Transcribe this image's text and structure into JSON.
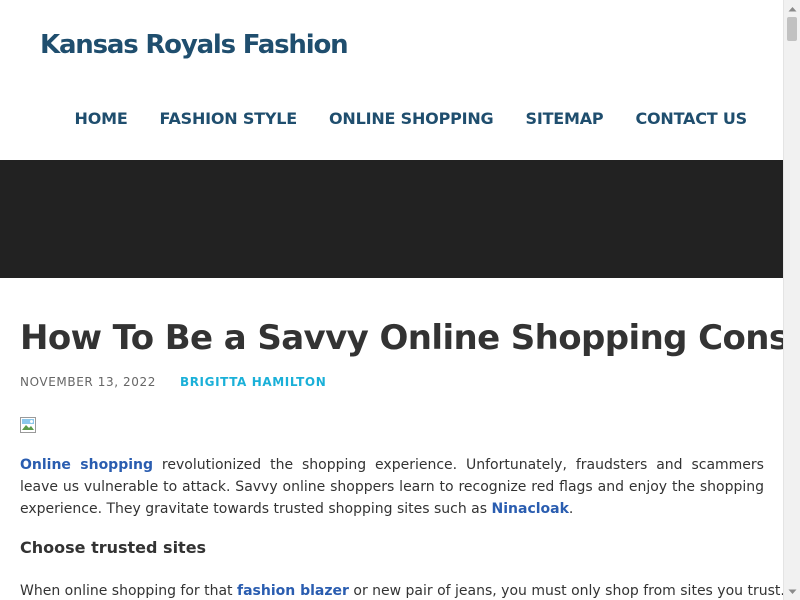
{
  "site": {
    "title": "Kansas Royals Fashion"
  },
  "nav": {
    "items": [
      {
        "label": "HOME"
      },
      {
        "label": "FASHION STYLE"
      },
      {
        "label": "ONLINE SHOPPING"
      },
      {
        "label": "SITEMAP"
      },
      {
        "label": "CONTACT US"
      }
    ]
  },
  "post": {
    "title": "How To Be a Savvy Online Shopping Consumer",
    "date": "NOVEMBER 13, 2022",
    "author": "BRIGITTA HAMILTON",
    "p1": {
      "link1": "Online shopping",
      "text1": " revolutionized the shopping experience. Unfortunately, fraudsters and scammers leave us vulnerable to attack. Savvy online shoppers learn to recognize red flags and enjoy the shopping experience. They gravitate towards trusted shopping sites such as ",
      "link2": "Ninacloak",
      "text2": "."
    },
    "subheading": "Choose trusted sites",
    "p2": {
      "text1": "When online shopping for that ",
      "link1": "fashion blazer",
      "text2": " or new pair of jeans, you must only shop from sites you trust. If you"
    }
  },
  "colors": {
    "title": "#1f4e6e",
    "nav": "#1f4e6e",
    "hero": "#222222",
    "author": "#1ab0d8",
    "link": "#2a5db0"
  },
  "icons": {
    "broken_image": "broken-image-icon",
    "scroll_up": "arrow-up-icon",
    "scroll_down": "arrow-down-icon"
  }
}
